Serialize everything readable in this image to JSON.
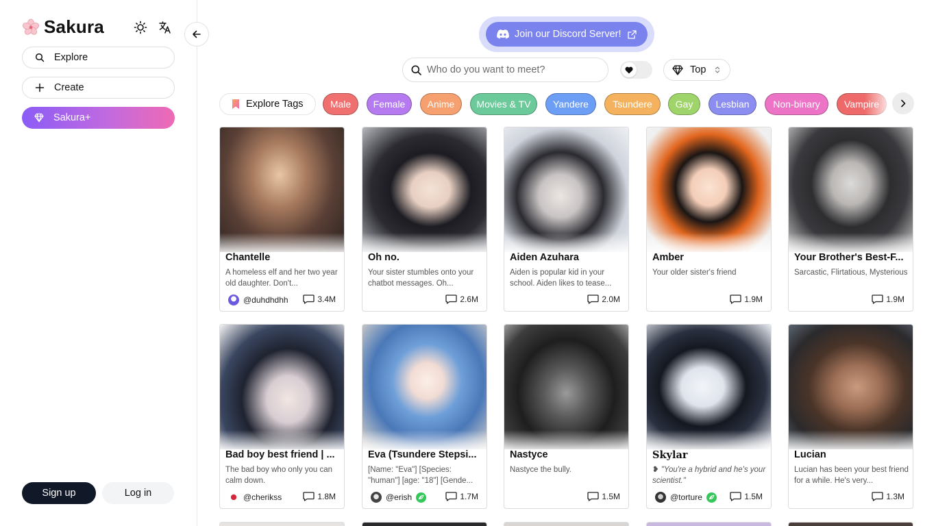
{
  "brand": {
    "name": "Sakura"
  },
  "sidebar": {
    "items": [
      {
        "label": "Explore",
        "icon": "search-icon"
      },
      {
        "label": "Create",
        "icon": "plus-icon"
      },
      {
        "label": "Sakura+",
        "icon": "diamond-icon"
      }
    ],
    "signup_label": "Sign up",
    "login_label": "Log in"
  },
  "header": {
    "discord_label": "Join our Discord Server!",
    "search_placeholder": "Who do you want to meet?",
    "sort_value": "Top"
  },
  "tags": {
    "explore_label": "Explore Tags",
    "items": [
      {
        "label": "Male",
        "color": "#f07070"
      },
      {
        "label": "Female",
        "color": "#b57af0"
      },
      {
        "label": "Anime",
        "color": "#f5a06e"
      },
      {
        "label": "Movies & TV",
        "color": "#6cc99a"
      },
      {
        "label": "Yandere",
        "color": "#6d9ef6"
      },
      {
        "label": "Tsundere",
        "color": "#f4b25e"
      },
      {
        "label": "Gay",
        "color": "#9fd46a"
      },
      {
        "label": "Lesbian",
        "color": "#8b8df0"
      },
      {
        "label": "Non-binary",
        "color": "#ed73c7"
      },
      {
        "label": "Vampire",
        "color": "#ee6a6a"
      }
    ]
  },
  "cards": [
    {
      "name": "Chantelle",
      "description": "A homeless elf and her two year old daughter. Don't...",
      "author": "@duhdhdhh",
      "count": "3.4M"
    },
    {
      "name": "Oh no.",
      "description": "Your sister stumbles onto your chatbot messages. Oh...",
      "author": "",
      "count": "2.6M"
    },
    {
      "name": "Aiden Azuhara",
      "description": "Aiden is popular kid in your school. Aiden likes to tease...",
      "author": "",
      "count": "2.0M"
    },
    {
      "name": "Amber",
      "description": "Your older sister's friend",
      "author": "",
      "count": "1.9M"
    },
    {
      "name": "Your Brother's Best-F...",
      "description": "Sarcastic, Flirtatious, Mysterious",
      "author": "",
      "count": "1.9M"
    },
    {
      "name": "Bad boy best friend | ...",
      "description": "The bad boy who only you can calm down.",
      "author": "@cherikss",
      "count": "1.8M"
    },
    {
      "name": "Eva (Tsundere Stepsi...",
      "description": "[Name: \"Eva\"] [Species: \"human\"] [age: \"18\"] [Gende...",
      "author": "@erish",
      "count": "1.7M"
    },
    {
      "name": "Nastyce",
      "description": "Nastyce the bully.",
      "author": "",
      "count": "1.5M"
    },
    {
      "name": "Skylar",
      "description": "❥ \"You're a hybrid and he's your scientist.\"",
      "author": "@torture",
      "count": "1.5M"
    },
    {
      "name": "Lucian",
      "description": "Lucian has been your best friend for a while. He's very...",
      "author": "",
      "count": "1.3M"
    }
  ],
  "colors": {
    "accent": "#8b5cf6",
    "discord": "#7a82ee",
    "dark_button": "#111827"
  }
}
